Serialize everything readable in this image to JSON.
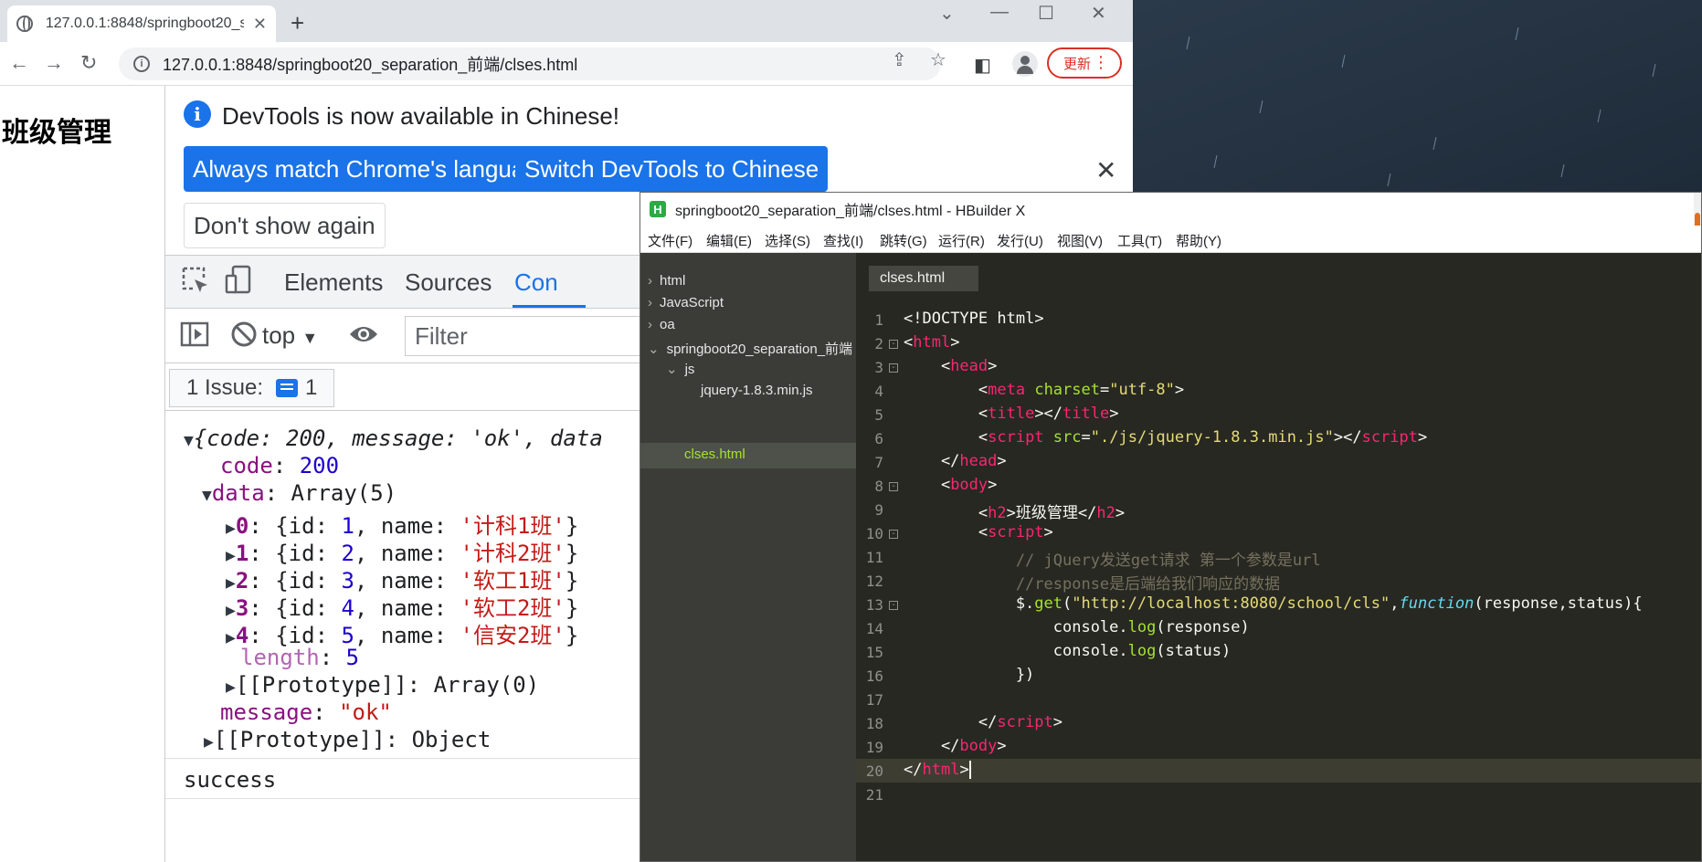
{
  "browser": {
    "tab_title": "127.0.0.1:8848/springboot20_s",
    "url": "127.0.0.1:8848/springboot20_separation_前端/clses.html",
    "update_label": "更新"
  },
  "page": {
    "heading": "班级管理"
  },
  "devtools": {
    "infobar": {
      "message": "DevTools is now available in Chinese!",
      "btn_match": "Always match Chrome's language",
      "btn_switch": "Switch DevTools to Chinese",
      "btn_dont_show": "Don't show again"
    },
    "tabs": [
      "Elements",
      "Sources",
      "Con"
    ],
    "console_bar": {
      "context": "top",
      "filter_placeholder": "Filter"
    },
    "issues": {
      "label": "1 Issue:",
      "count": "1"
    },
    "output": {
      "obj_summary": "{code: 200, message: 'ok', data",
      "code_line": {
        "key": "code",
        "value": "200"
      },
      "data_line": {
        "key": "data",
        "value": "Array(5)"
      },
      "items": [
        {
          "idx": "0",
          "id": "1",
          "name": "'计科1班'"
        },
        {
          "idx": "1",
          "id": "2",
          "name": "'计科2班'"
        },
        {
          "idx": "2",
          "id": "3",
          "name": "'软工1班'"
        },
        {
          "idx": "3",
          "id": "4",
          "name": "'软工2班'"
        },
        {
          "idx": "4",
          "id": "5",
          "name": "'信安2班'"
        }
      ],
      "length_line": {
        "key": "length",
        "value": "5"
      },
      "proto_array": "[[Prototype]]: Array(0)",
      "message_line": {
        "key": "message",
        "value": "\"ok\""
      },
      "proto_object": "[[Prototype]]: Object",
      "status_log": "success"
    }
  },
  "hbuilder": {
    "title": "springboot20_separation_前端/clses.html - HBuilder X",
    "menu": [
      "文件(F)",
      "编辑(E)",
      "选择(S)",
      "查找(I)",
      "跳转(G)",
      "运行(R)",
      "发行(U)",
      "视图(V)",
      "工具(T)",
      "帮助(Y)"
    ],
    "project_tree": [
      {
        "label": "html",
        "chevron": "›"
      },
      {
        "label": "JavaScript",
        "chevron": "›"
      },
      {
        "label": "oa",
        "chevron": "›"
      },
      {
        "label": "springboot20_separation_前端",
        "chevron": "⌄"
      },
      {
        "label": "js",
        "chevron": "⌄"
      },
      {
        "label": "jquery-1.8.3.min.js",
        "chevron": ""
      },
      {
        "label": "clses.html",
        "chevron": ""
      }
    ],
    "editor_tab": "clses.html",
    "line_numbers": [
      "1",
      "2",
      "3",
      "4",
      "5",
      "6",
      "7",
      "8",
      "9",
      "10",
      "11",
      "12",
      "13",
      "14",
      "15",
      "16",
      "17",
      "18",
      "19",
      "20",
      "21"
    ]
  }
}
